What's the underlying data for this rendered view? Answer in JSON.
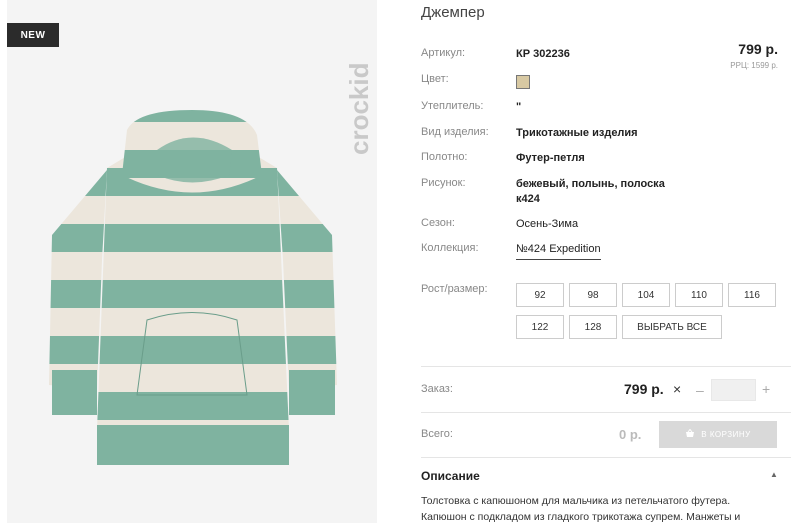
{
  "badge": "NEW",
  "brand": "crockid",
  "product": {
    "title": "Джемпер",
    "price": "799 р.",
    "rrp": "РРЦ: 1599 р.",
    "swatch_color": "#d8c9a3",
    "attributes": [
      {
        "label": "Артикул:",
        "value": "КР 302236"
      },
      {
        "label": "Цвет:",
        "value": ""
      },
      {
        "label": "Утеплитель:",
        "value": "\""
      },
      {
        "label": "Вид изделия:",
        "value": "Трикотажные изделия"
      },
      {
        "label": "Полотно:",
        "value": "Футер-петля"
      },
      {
        "label": "Рисунок:",
        "value": "бежевый, полынь, полоска к424"
      },
      {
        "label": "Сезон:",
        "value": "Осень-Зима"
      },
      {
        "label": "Коллекция:",
        "value": "№424 Expedition"
      }
    ]
  },
  "sizes": {
    "label": "Рост/размер:",
    "options": [
      "92",
      "98",
      "104",
      "110",
      "116",
      "122",
      "128"
    ],
    "select_all": "ВЫБРАТЬ ВСЕ"
  },
  "order": {
    "label": "Заказ:",
    "price": "799 р.",
    "multiply": "×",
    "minus": "–",
    "plus": "+",
    "quantity": ""
  },
  "total": {
    "label": "Всего:",
    "value": "0 р.",
    "cart_button": "В КОРЗИНУ"
  },
  "description": {
    "title": "Описание",
    "text": "Толстовка с капюшоном для мальчика из петельчатого футера. Капюшон с подкладом из гладкого трикотажа супрем. Манжеты и"
  },
  "colors": {
    "stripe_green": "#7fb3a0",
    "stripe_cream": "#ece6dc",
    "dark": "#2b2b2b"
  }
}
